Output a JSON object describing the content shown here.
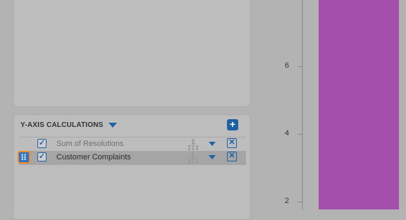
{
  "y_axis_section": {
    "title": "Y-AXIS CALCULATIONS",
    "add_label": "+",
    "rows": [
      {
        "label": "Sum of Resolutions",
        "checked": true,
        "check_mark": "✓",
        "remove_label": "✕"
      },
      {
        "label": "Customer Complaints",
        "checked": true,
        "check_mark": "✓",
        "remove_label": "✕"
      }
    ]
  },
  "colors": {
    "accent": "#1f5fa3",
    "bar": "#a44fab",
    "drag_handle_border": "#f08a21"
  },
  "chart_data": {
    "type": "bar",
    "y_ticks": [
      "2",
      "4",
      "6"
    ],
    "series": [
      {
        "values": [
          8
        ]
      }
    ]
  }
}
